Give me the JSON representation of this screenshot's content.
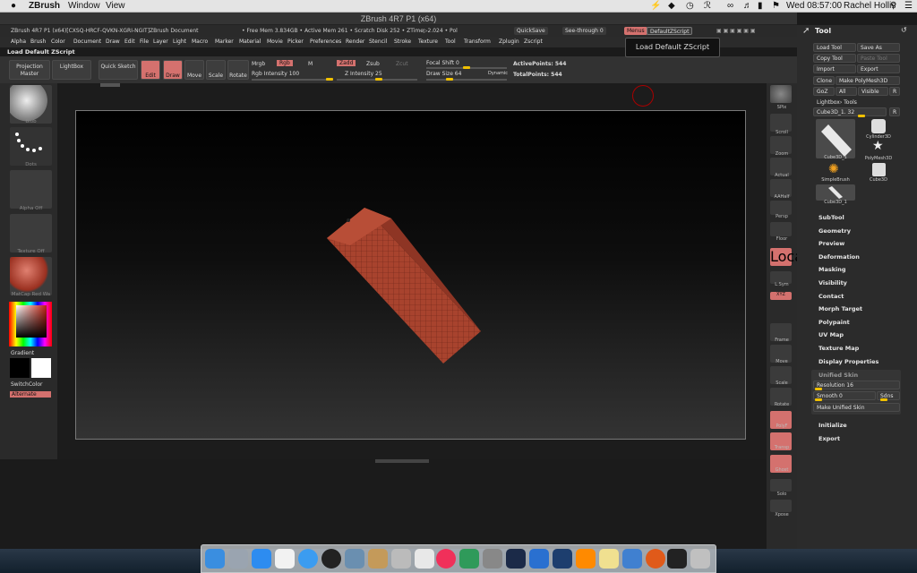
{
  "macbar": {
    "apple": "",
    "app": "ZBrush",
    "menus": [
      "Window",
      "View"
    ],
    "clock": "Wed 08:57:00",
    "user": "Rachel Hollis"
  },
  "window": {
    "title": "ZBrush 4R7 P1 (x64)"
  },
  "infobar": {
    "left": "ZBrush 4R7 P1 (x64)[CXSQ-HRCF-QVKN-XGRI-NGIT]ZBrush Document",
    "mem": "• Free Mem 3.834GB • Active Mem 261 • Scratch Disk 252 • ZTime▷2.024 • Pol",
    "quicksave": "QuickSave",
    "seethrough": "See-through  0",
    "menus": "Menus",
    "defaultzscript": "DefaultZScript"
  },
  "menubar": [
    "Alpha",
    "Brush",
    "Color",
    "Document",
    "Draw",
    "Edit",
    "File",
    "Layer",
    "Light",
    "Macro",
    "Marker",
    "Material",
    "Movie",
    "Picker",
    "Preferences",
    "Render",
    "Stencil",
    "Stroke",
    "Texture",
    "Tool",
    "Transform",
    "Zplugin",
    "Zscript"
  ],
  "scriptline": "Load Default ZScript",
  "tooltip": "Load Default ZScript",
  "toolbar": {
    "projection": "Projection Master",
    "lightbox": "LightBox",
    "quicksketch": "Quick Sketch",
    "edit": "Edit",
    "draw": "Draw",
    "move": "Move",
    "scale": "Scale",
    "rotate": "Rotate",
    "mrgb": "Mrgb",
    "rgb": "Rgb",
    "m": "M",
    "rgbint": "Rgb Intensity 100",
    "zadd": "Zadd",
    "zsub": "Zsub",
    "zcut": "Zcut",
    "zint": "Z Intensity 25",
    "focal": "Focal Shift 0",
    "drawsize": "Draw Size 64",
    "dynamic": "Dynamic",
    "active": "ActivePoints: 544",
    "total": "TotalPoints: 544"
  },
  "leftshelf": {
    "blob": "Blob",
    "dots": "Dots",
    "alpha": "Alpha Off",
    "texture": "Texture Off",
    "matcap": "MatCap Red Wa",
    "gradient": "Gradient",
    "switchcolor": "SwitchColor",
    "alternate": "Alternate"
  },
  "rightshelf": [
    "SPix",
    "Scroll",
    "Zoom",
    "Actual",
    "AAHalf",
    "Persp",
    "Floor",
    "Local",
    "L.Sym",
    "XYZ",
    "Frame",
    "Move",
    "Scale",
    "Rotate",
    "PolyF",
    "Transp",
    "Ghost",
    "Solo",
    "Xpose"
  ],
  "toolpanel": {
    "title": "Tool",
    "loadtool": "Load Tool",
    "saveas": "Save As",
    "copytool": "Copy Tool",
    "pastetool": "Paste Tool",
    "import": "Import",
    "export": "Export",
    "clone": "Clone",
    "makepoly": "Make PolyMesh3D",
    "goz": "GoZ",
    "all": "All",
    "visible": "Visible",
    "r": "R",
    "lightboxtools": "Lightbox› Tools",
    "current": "Cube3D_1. 32",
    "tools": [
      "Cube3D_1",
      "Cylinder3D",
      "PolyMesh3D",
      "SimpleBrush",
      "Cube3D",
      "Cube3D_1"
    ],
    "sections": [
      "SubTool",
      "Geometry",
      "Preview",
      "Deformation",
      "Masking",
      "Visibility",
      "Contact",
      "Morph Target",
      "Polypaint",
      "UV Map",
      "Texture Map",
      "Display Properties"
    ],
    "unified": "Unified Skin",
    "resolution": "Resolution 16",
    "smooth": "Smooth 0",
    "sdns": "Sdns",
    "makeunified": "Make Unified Skin",
    "initialize": "Initialize",
    "exportsec": "Export"
  }
}
